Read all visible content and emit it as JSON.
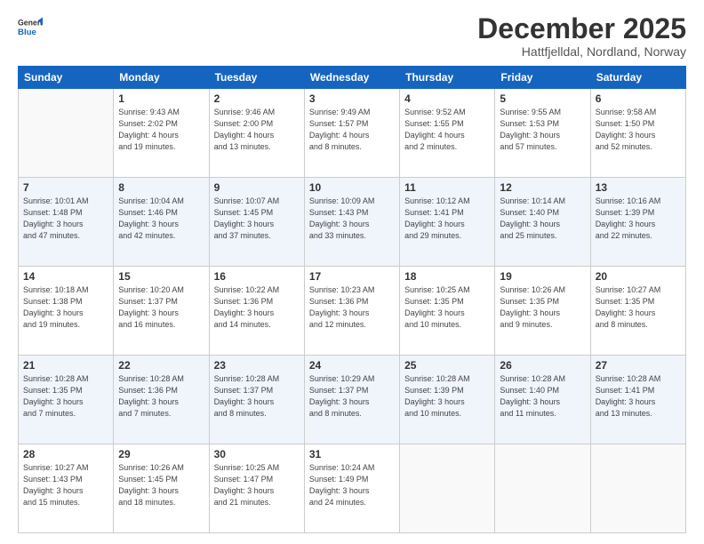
{
  "logo": {
    "general": "General",
    "blue": "Blue"
  },
  "title": "December 2025",
  "subtitle": "Hattfjelldal, Nordland, Norway",
  "days_header": [
    "Sunday",
    "Monday",
    "Tuesday",
    "Wednesday",
    "Thursday",
    "Friday",
    "Saturday"
  ],
  "weeks": [
    [
      {
        "day": "",
        "info": ""
      },
      {
        "day": "1",
        "info": "Sunrise: 9:43 AM\nSunset: 2:02 PM\nDaylight: 4 hours\nand 19 minutes."
      },
      {
        "day": "2",
        "info": "Sunrise: 9:46 AM\nSunset: 2:00 PM\nDaylight: 4 hours\nand 13 minutes."
      },
      {
        "day": "3",
        "info": "Sunrise: 9:49 AM\nSunset: 1:57 PM\nDaylight: 4 hours\nand 8 minutes."
      },
      {
        "day": "4",
        "info": "Sunrise: 9:52 AM\nSunset: 1:55 PM\nDaylight: 4 hours\nand 2 minutes."
      },
      {
        "day": "5",
        "info": "Sunrise: 9:55 AM\nSunset: 1:53 PM\nDaylight: 3 hours\nand 57 minutes."
      },
      {
        "day": "6",
        "info": "Sunrise: 9:58 AM\nSunset: 1:50 PM\nDaylight: 3 hours\nand 52 minutes."
      }
    ],
    [
      {
        "day": "7",
        "info": "Sunrise: 10:01 AM\nSunset: 1:48 PM\nDaylight: 3 hours\nand 47 minutes."
      },
      {
        "day": "8",
        "info": "Sunrise: 10:04 AM\nSunset: 1:46 PM\nDaylight: 3 hours\nand 42 minutes."
      },
      {
        "day": "9",
        "info": "Sunrise: 10:07 AM\nSunset: 1:45 PM\nDaylight: 3 hours\nand 37 minutes."
      },
      {
        "day": "10",
        "info": "Sunrise: 10:09 AM\nSunset: 1:43 PM\nDaylight: 3 hours\nand 33 minutes."
      },
      {
        "day": "11",
        "info": "Sunrise: 10:12 AM\nSunset: 1:41 PM\nDaylight: 3 hours\nand 29 minutes."
      },
      {
        "day": "12",
        "info": "Sunrise: 10:14 AM\nSunset: 1:40 PM\nDaylight: 3 hours\nand 25 minutes."
      },
      {
        "day": "13",
        "info": "Sunrise: 10:16 AM\nSunset: 1:39 PM\nDaylight: 3 hours\nand 22 minutes."
      }
    ],
    [
      {
        "day": "14",
        "info": "Sunrise: 10:18 AM\nSunset: 1:38 PM\nDaylight: 3 hours\nand 19 minutes."
      },
      {
        "day": "15",
        "info": "Sunrise: 10:20 AM\nSunset: 1:37 PM\nDaylight: 3 hours\nand 16 minutes."
      },
      {
        "day": "16",
        "info": "Sunrise: 10:22 AM\nSunset: 1:36 PM\nDaylight: 3 hours\nand 14 minutes."
      },
      {
        "day": "17",
        "info": "Sunrise: 10:23 AM\nSunset: 1:36 PM\nDaylight: 3 hours\nand 12 minutes."
      },
      {
        "day": "18",
        "info": "Sunrise: 10:25 AM\nSunset: 1:35 PM\nDaylight: 3 hours\nand 10 minutes."
      },
      {
        "day": "19",
        "info": "Sunrise: 10:26 AM\nSunset: 1:35 PM\nDaylight: 3 hours\nand 9 minutes."
      },
      {
        "day": "20",
        "info": "Sunrise: 10:27 AM\nSunset: 1:35 PM\nDaylight: 3 hours\nand 8 minutes."
      }
    ],
    [
      {
        "day": "21",
        "info": "Sunrise: 10:28 AM\nSunset: 1:35 PM\nDaylight: 3 hours\nand 7 minutes."
      },
      {
        "day": "22",
        "info": "Sunrise: 10:28 AM\nSunset: 1:36 PM\nDaylight: 3 hours\nand 7 minutes."
      },
      {
        "day": "23",
        "info": "Sunrise: 10:28 AM\nSunset: 1:37 PM\nDaylight: 3 hours\nand 8 minutes."
      },
      {
        "day": "24",
        "info": "Sunrise: 10:29 AM\nSunset: 1:37 PM\nDaylight: 3 hours\nand 8 minutes."
      },
      {
        "day": "25",
        "info": "Sunrise: 10:28 AM\nSunset: 1:39 PM\nDaylight: 3 hours\nand 10 minutes."
      },
      {
        "day": "26",
        "info": "Sunrise: 10:28 AM\nSunset: 1:40 PM\nDaylight: 3 hours\nand 11 minutes."
      },
      {
        "day": "27",
        "info": "Sunrise: 10:28 AM\nSunset: 1:41 PM\nDaylight: 3 hours\nand 13 minutes."
      }
    ],
    [
      {
        "day": "28",
        "info": "Sunrise: 10:27 AM\nSunset: 1:43 PM\nDaylight: 3 hours\nand 15 minutes."
      },
      {
        "day": "29",
        "info": "Sunrise: 10:26 AM\nSunset: 1:45 PM\nDaylight: 3 hours\nand 18 minutes."
      },
      {
        "day": "30",
        "info": "Sunrise: 10:25 AM\nSunset: 1:47 PM\nDaylight: 3 hours\nand 21 minutes."
      },
      {
        "day": "31",
        "info": "Sunrise: 10:24 AM\nSunset: 1:49 PM\nDaylight: 3 hours\nand 24 minutes."
      },
      {
        "day": "",
        "info": ""
      },
      {
        "day": "",
        "info": ""
      },
      {
        "day": "",
        "info": ""
      }
    ]
  ]
}
